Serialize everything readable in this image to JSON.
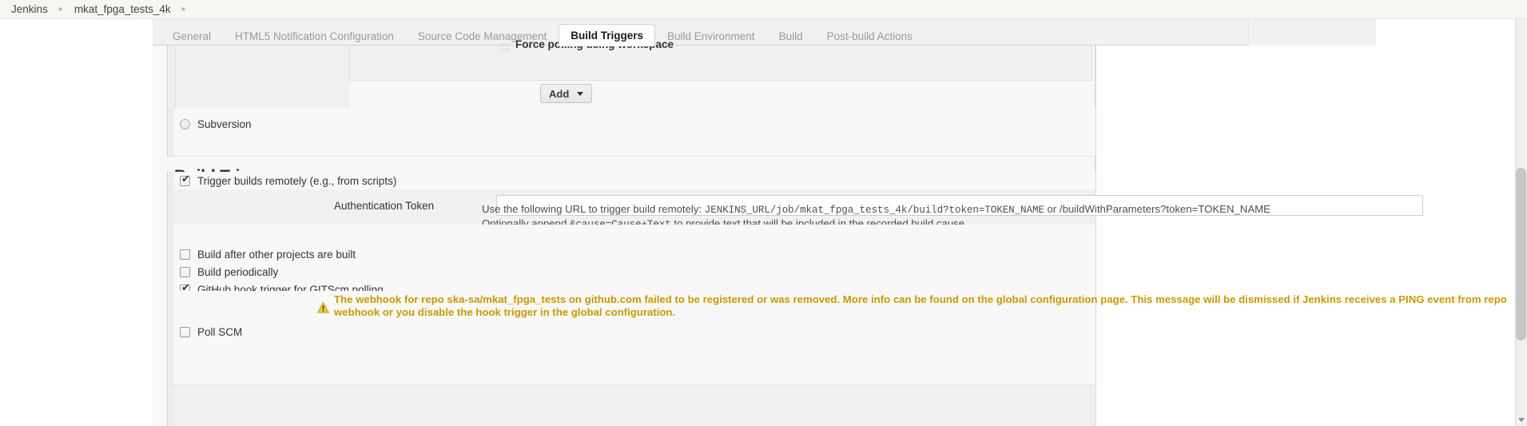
{
  "breadcrumb": {
    "items": [
      {
        "label": "Jenkins"
      },
      {
        "label": "mkat_fpga_tests_4k"
      }
    ],
    "separator": "▸"
  },
  "tabs": [
    {
      "label": "General",
      "active": false
    },
    {
      "label": "HTML5 Notification Configuration",
      "active": false
    },
    {
      "label": "Source Code Management",
      "active": false
    },
    {
      "label": "Build Triggers",
      "active": true
    },
    {
      "label": "Build Environment",
      "active": false
    },
    {
      "label": "Build",
      "active": false
    },
    {
      "label": "Post-build Actions",
      "active": false
    }
  ],
  "scm_block": {
    "force_polling_label": "Force polling using workspace",
    "drag_handle_icon": "drag-handle-icon",
    "add_button_label": "Add",
    "add_button_caret_icon": "chevron-down-icon",
    "subversion_label": "Subversion",
    "subversion_checked": false
  },
  "section": {
    "heading": "Build Triggers"
  },
  "triggers": {
    "trigger_remotely": {
      "label": "Trigger builds remotely (e.g., from scripts)",
      "checked": true
    },
    "auth_token": {
      "label": "Authentication Token",
      "value": "",
      "placeholder": ""
    },
    "help": {
      "line1_pre": "Use the following URL to trigger build remotely: ",
      "line1_mono1": "JENKINS_URL/job/mkat_fpga_tests_4k/build?token=TOKEN_NAME",
      "line1_mid": " or ",
      "line1_mono2": "/buildWithParameters?token=TOKEN_NAME",
      "line2_pre": "Optionally append ",
      "line2_mono": "&cause=Cause+Text",
      "line2_post": " to provide text that will be included in the recorded build cause."
    },
    "build_after_other": {
      "label": "Build after other projects are built",
      "checked": false
    },
    "build_periodically": {
      "label": "Build periodically",
      "checked": false
    },
    "github_hook": {
      "label": "GitHub hook trigger for GITScm polling",
      "checked": true
    },
    "warning": {
      "icon": "warning-triangle-icon",
      "text": "The webhook for repo ska-sa/mkat_fpga_tests on github.com failed to be registered or was removed. More info can be found on the global configuration page. This message will be dismissed if Jenkins receives a PING event from repo webhook or you disable the hook trigger in the global configuration.",
      "color": "#c79a00"
    },
    "poll_scm": {
      "label": "Poll SCM",
      "checked": false
    }
  },
  "scrollbar": {
    "up_icon": "scroll-up-arrow-icon",
    "down_icon": "scroll-down-arrow-icon"
  }
}
